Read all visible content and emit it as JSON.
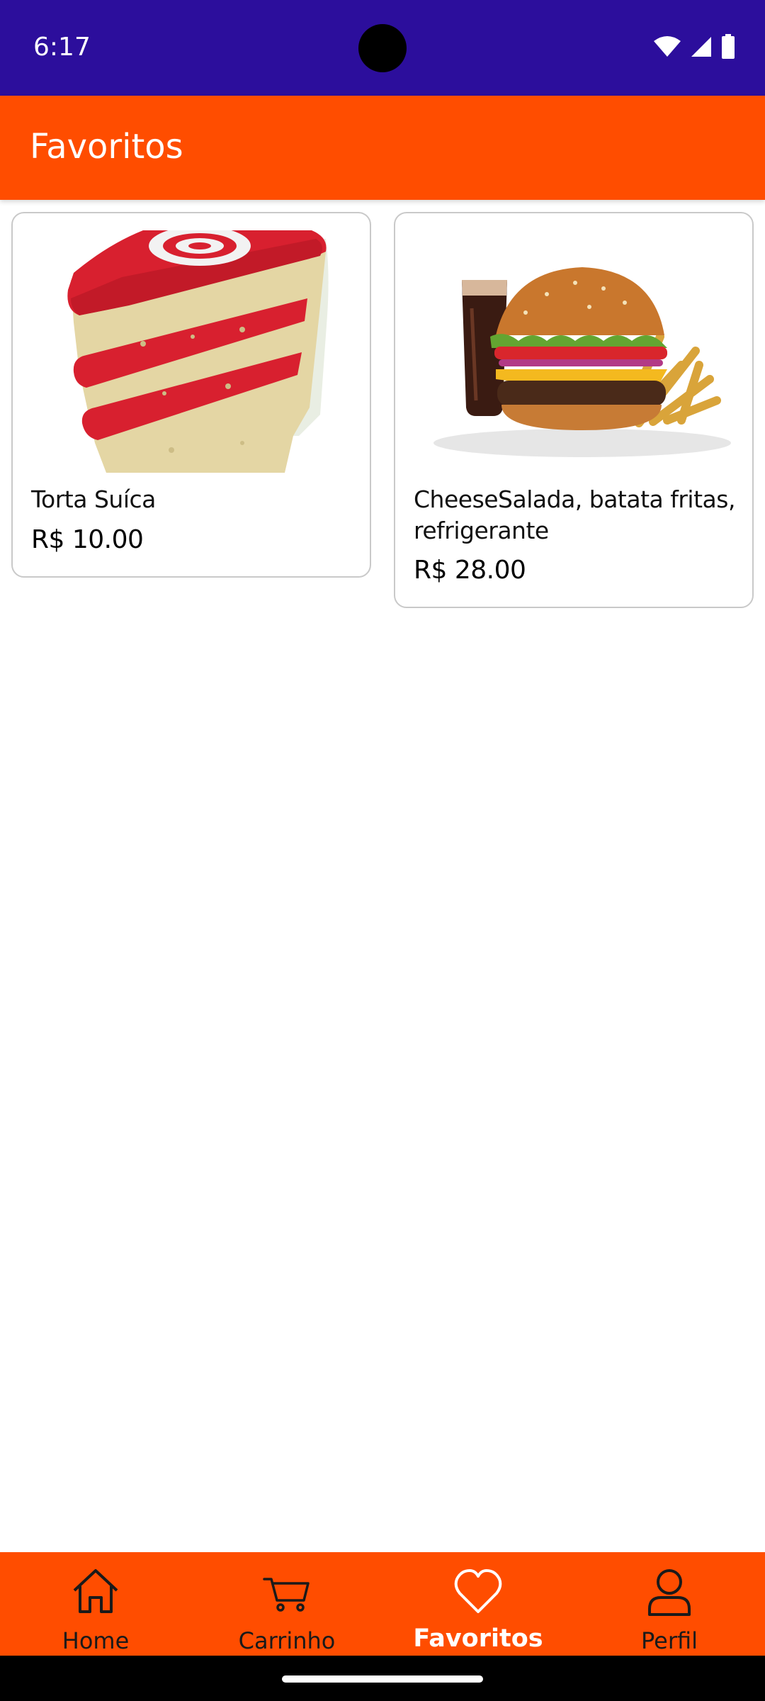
{
  "status_bar": {
    "time": "6:17",
    "icons": [
      "wifi-icon",
      "signal-icon",
      "battery-icon"
    ],
    "color": "#2c0e9c"
  },
  "app_bar": {
    "title": "Favoritos",
    "color": "#ff4d00"
  },
  "favorites": [
    {
      "name": "Torta Suíca",
      "price": "R$ 10.00",
      "image": "cake-slice-image"
    },
    {
      "name": "CheeseSalada, batata fritas, refrigerante",
      "price": "R$ 28.00",
      "image": "burger-combo-image"
    }
  ],
  "bottom_nav": {
    "items": [
      {
        "label": "Home",
        "icon": "home-icon",
        "active": false
      },
      {
        "label": "Carrinho",
        "icon": "cart-icon",
        "active": false
      },
      {
        "label": "Favoritos",
        "icon": "heart-icon",
        "active": true
      },
      {
        "label": "Perfil",
        "icon": "person-icon",
        "active": false
      }
    ]
  }
}
